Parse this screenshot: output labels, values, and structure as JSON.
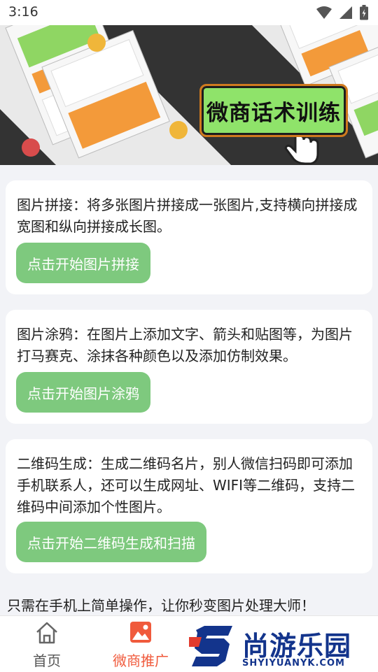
{
  "status_bar": {
    "time": "3:16",
    "icons": [
      "wifi-icon",
      "signal-icon",
      "battery-icon"
    ]
  },
  "banner": {
    "title": "微商话术训练",
    "diagonal_caption": "微商话术训练",
    "icon": "hand-pointer-icon"
  },
  "cards": [
    {
      "description": "图片拼接：将多张图片拼接成一张图片,支持横向拼接成宽图和纵向拼接成长图。",
      "button_label": "点击开始图片拼接"
    },
    {
      "description": "图片涂鸦：在图片上添加文字、箭头和贴图等，为图片打马赛克、涂抹各种颜色以及添加仿制效果。",
      "button_label": "点击开始图片涂鸦"
    },
    {
      "description": "二维码生成：生成二维码名片，别人微信扫码即可添加手机联系人，还可以生成网址、WIFI等二维码，支持二维码中间添加个性图片。",
      "button_label": "点击开始二维码生成和扫描"
    }
  ],
  "footer_text": "只需在手机上简单操作，让你秒变图片处理大师！",
  "bottom_nav": {
    "items": [
      {
        "label": "首页",
        "icon": "home-icon",
        "active": false
      },
      {
        "label": "微商推广",
        "icon": "image-icon",
        "active": true
      }
    ]
  },
  "watermark": {
    "text": "尚游乐园",
    "url": "SHYIYUANYK.COM"
  },
  "colors": {
    "accent": "#f05a3c",
    "button": "#7ec97e",
    "background": "#f2f3f7",
    "watermark": "#13348c"
  }
}
